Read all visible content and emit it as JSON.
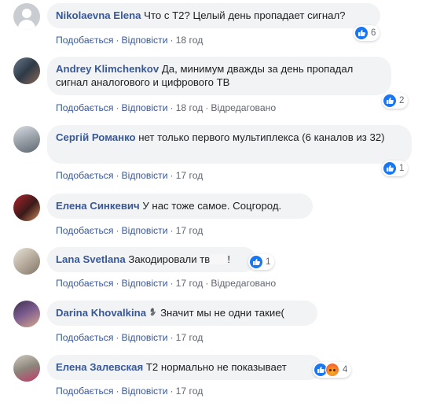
{
  "actions": {
    "like": "Подобається",
    "reply": "Відповісти",
    "edited": "Відредаговано",
    "dot": "·"
  },
  "colors": {
    "name": "#385898",
    "bubble": "#f2f3f5",
    "like": "#1877f2"
  },
  "comments": [
    {
      "name": "Nikolaevna Elena",
      "text": "Что с Т2? Целый день пропадает сигнал?",
      "time": "18 год",
      "reactions": [
        "like-icon"
      ],
      "count": "6",
      "avatar": "default-avatar"
    },
    {
      "name": "Andrey Klimchenkov",
      "text": "Да, минимум дважды за день пропадал сигнал аналогового и цифрового ТВ",
      "time": "18 год",
      "edited": true,
      "reactions": [
        "like-icon"
      ],
      "count": "2",
      "avatar": "photo"
    },
    {
      "name": "Сергій Романко",
      "text": "нет только первого мультиплекса (6 каналов из 32)",
      "time": "17 год",
      "reactions": [
        "like-icon"
      ],
      "count": "1",
      "avatar": "photo"
    },
    {
      "name": "Елена Синкевич",
      "text": "У нас тоже самое. Соцгород.",
      "time": "17 год",
      "reactions": [],
      "avatar": "photo"
    },
    {
      "name": "Lana Svetlana",
      "text": "Закодировали тв",
      "text_end": "!",
      "time": "17 год",
      "edited": true,
      "reactions": [
        "like-icon"
      ],
      "count": "1",
      "avatar": "photo"
    },
    {
      "name": "Darina Khovalkina",
      "text": "Значит мы не одни такие(",
      "time": "17 год",
      "reactions": [],
      "avatar": "photo"
    },
    {
      "name": "Елена Залевская",
      "text": "Т2 нормально не показывает",
      "time": "17 год",
      "reactions": [
        "like-icon",
        "angry-icon"
      ],
      "count": "4",
      "avatar": "photo"
    }
  ]
}
